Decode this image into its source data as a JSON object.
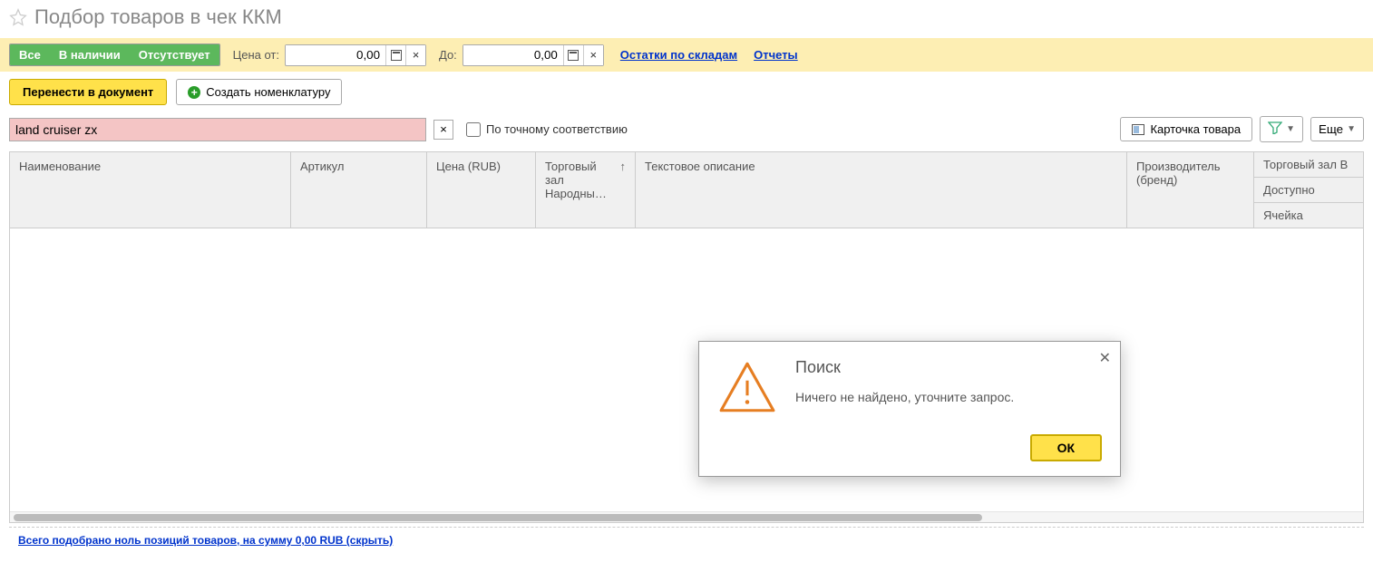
{
  "header": {
    "title": "Подбор товаров в чек ККМ"
  },
  "filter": {
    "all": "Все",
    "instock": "В наличии",
    "outstock": "Отсутствует",
    "price_from_label": "Цена от:",
    "price_from_value": "0,00",
    "price_to_label": "До:",
    "price_to_value": "0,00",
    "balance_link": "Остатки по складам",
    "reports_link": "Отчеты"
  },
  "toolbar": {
    "transfer": "Перенести в документ",
    "create": "Создать номенклатуру"
  },
  "search": {
    "value": "land cruiser zx",
    "exact_label": "По точному соответствию",
    "card_btn": "Карточка товара",
    "more_btn": "Еще"
  },
  "table": {
    "cols": {
      "name": "Наименование",
      "article": "Артикул",
      "price": "Цена (RUB)",
      "stock": "Торговый зал Народны…",
      "desc": "Текстовое описание",
      "brand": "Производитель (бренд)",
      "hall": "Торговый зал В",
      "available": "Доступно",
      "cell": "Ячейка"
    }
  },
  "dialog": {
    "title": "Поиск",
    "message": "Ничего не найдено, уточните запрос.",
    "ok": "ОК"
  },
  "footer": {
    "summary": "Всего подобрано ноль позиций товаров, на сумму 0,00 RUB (скрыть)"
  }
}
